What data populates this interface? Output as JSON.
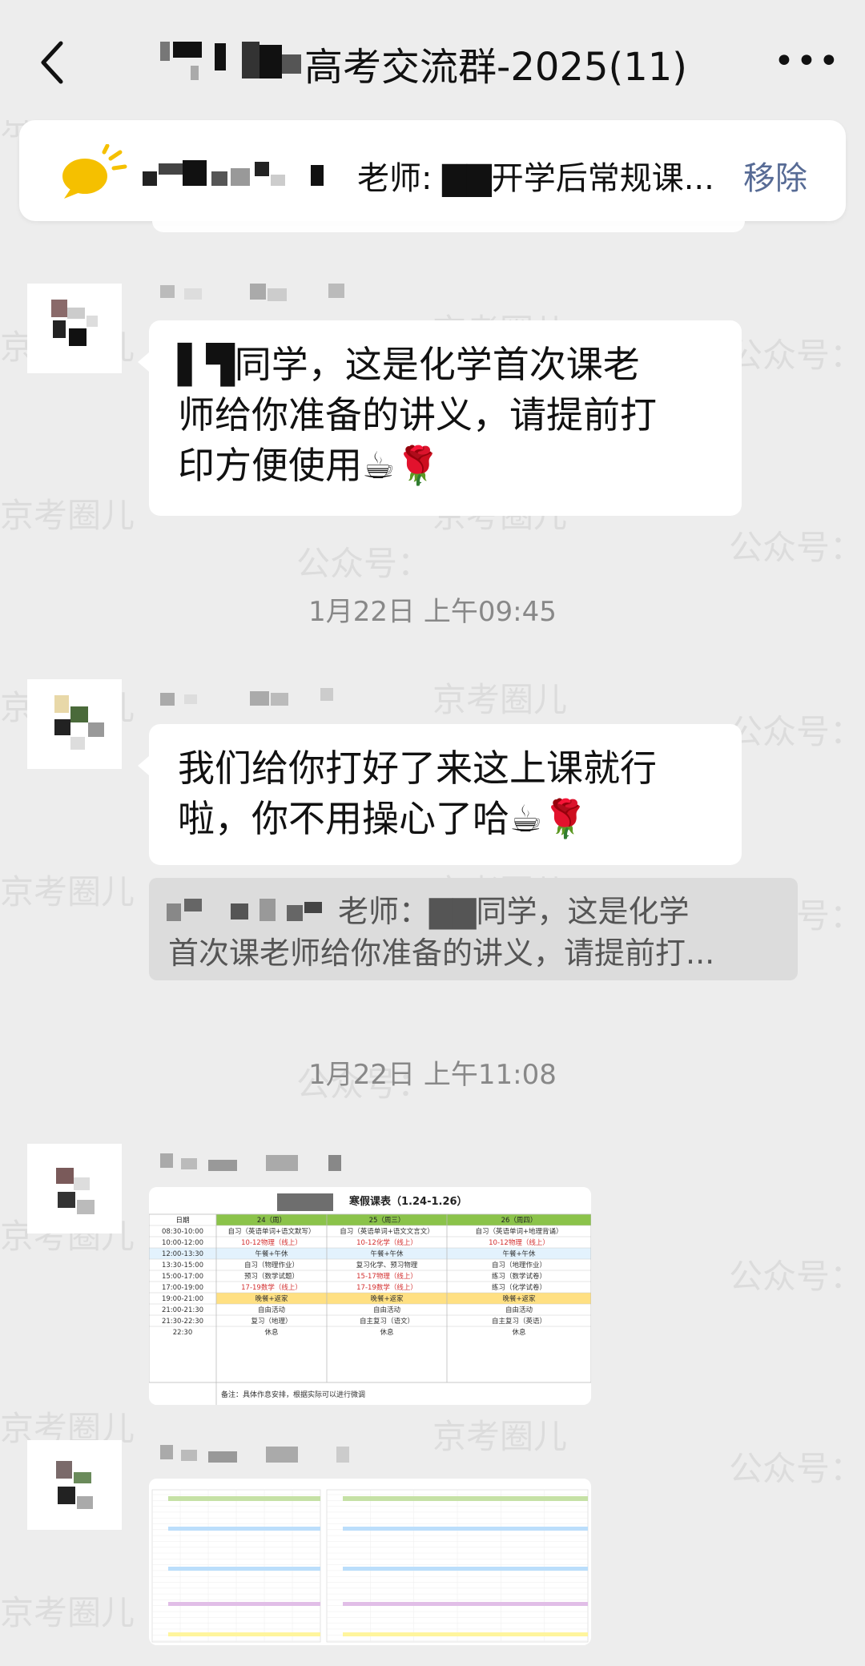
{
  "header": {
    "title": "高考交流群-2025(11)",
    "back_icon": "chevron-left-icon",
    "more_icon": "ellipsis-icon"
  },
  "pinned": {
    "text": "老师: ▇▇开学后常规课...",
    "remove_label": "移除",
    "icon": "megaphone-icon"
  },
  "messages": [
    {
      "bubble": [
        "▌▜同学，这是化学首次课老",
        "师给你准备的讲义，请提前打",
        "印方便使用☕🌹"
      ]
    },
    {
      "time": "1月22日 上午09:45",
      "bubble": [
        "我们给你打好了来这上课就行",
        "啦，你不用操心了哈☕🌹"
      ],
      "quote": [
        "老师：▇▇同学，这是化学",
        "首次课老师给你准备的讲义，请提前打..."
      ]
    },
    {
      "time": "1月22日 上午11:08",
      "image_title": "寒假课表（1.24-1.26）"
    }
  ],
  "schedule": {
    "headers": [
      "日期",
      "24（周）",
      "25（周三）",
      "26（周四）"
    ],
    "rows": [
      [
        "08:30-10:00",
        "自习（英语单词+语文默写）",
        "自习（英语单词+语文文言文）",
        "自习（英语单词+地理背诵）"
      ],
      [
        "10:00-12:00",
        "10-12物理（线上）",
        "10-12化学（线上）",
        "10-12物理（线上）"
      ],
      [
        "12:00-13:30",
        "午餐+午休",
        "午餐+午休",
        "午餐+午休"
      ],
      [
        "13:30-15:00",
        "自习（物理作业）",
        "复习化学、预习物理",
        "自习（地理作业）"
      ],
      [
        "15:00-17:00",
        "预习（数学试题）",
        "15-17物理（线上）",
        "练习（数学试卷）"
      ],
      [
        "17:00-19:00",
        "17-19数学（线上）",
        "17-19数学（线上）",
        "练习（化学试卷）"
      ],
      [
        "19:00-21:00",
        "晚餐+返家",
        "晚餐+返家",
        "晚餐+返家"
      ],
      [
        "21:00-21:30",
        "自由活动",
        "自由活动",
        "自由活动"
      ],
      [
        "21:30-22:30",
        "复习（地理）",
        "自主复习（语文）",
        "自主复习（英语）"
      ],
      [
        "22:30",
        "休息",
        "休息",
        "休息"
      ]
    ],
    "note": "备注：具体作息安排，根据实际可以进行微调"
  },
  "watermarks": [
    "京考圈儿",
    "公众号："
  ]
}
